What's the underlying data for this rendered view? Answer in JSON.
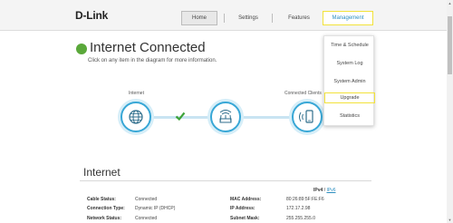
{
  "header": {
    "logo": "D-Link",
    "nav": {
      "home": "Home",
      "settings": "Settings",
      "features": "Features",
      "management": "Management"
    }
  },
  "management_menu": {
    "items": [
      "Time & Schedule",
      "System Log",
      "System Admin",
      "Upgrade",
      "Statistics"
    ]
  },
  "status": {
    "title": "Internet Connected",
    "subtitle": "Click on any item in the diagram for more information.",
    "color": "#5aa83a"
  },
  "diagram": {
    "internet_label": "Internet",
    "clients_label": "Connected Clients",
    "accent_color": "#38a7d6"
  },
  "internet_section": {
    "title": "Internet",
    "tab_ipv4": "IPv4",
    "tab_separator": "/",
    "tab_ipv6": "IPv6",
    "rows": [
      {
        "label": "Cable Status:",
        "value": "Connected"
      },
      {
        "label": "Connection Type:",
        "value": "Dynamic IP (DHCP)"
      },
      {
        "label": "Network Status:",
        "value": "Connected"
      }
    ],
    "rows_right": [
      {
        "label": "MAC Address:",
        "value": "80:26:89:5F:FE:F6"
      },
      {
        "label": "IP Address:",
        "value": "172.17.2.98"
      },
      {
        "label": "Subnet Mask:",
        "value": "255.255.255.0"
      }
    ]
  }
}
